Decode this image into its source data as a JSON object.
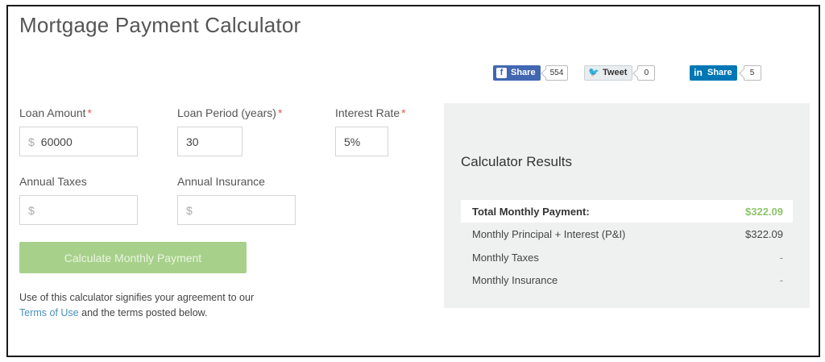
{
  "page": {
    "title": "Mortgage Payment Calculator"
  },
  "social": {
    "facebook": {
      "label": "Share",
      "count": "554",
      "icon": "f"
    },
    "twitter": {
      "label": "Tweet",
      "count": "0",
      "icon": "🐦"
    },
    "linkedin": {
      "label": "Share",
      "count": "5",
      "icon": "in"
    }
  },
  "form": {
    "loan_amount": {
      "label": "Loan Amount",
      "required": "*",
      "prefix": "$",
      "value": "60000"
    },
    "loan_period": {
      "label": "Loan Period (years)",
      "required": "*",
      "value": "30"
    },
    "interest_rate": {
      "label": "Interest Rate",
      "required": "*",
      "value": "5%"
    },
    "annual_taxes": {
      "label": "Annual Taxes",
      "prefix": "$",
      "value": ""
    },
    "annual_insurance": {
      "label": "Annual Insurance",
      "prefix": "$",
      "value": ""
    },
    "calculate_label": "Calculate Monthly Payment"
  },
  "disclaimer": {
    "before": "Use of this calculator signifies your agreement to our ",
    "link": "Terms of Use",
    "after": " and the terms posted below."
  },
  "results": {
    "title": "Calculator Results",
    "rows": [
      {
        "label": "Total Monthly Payment:",
        "value": "$322.09"
      },
      {
        "label": "Monthly Principal + Interest (P&I)",
        "value": "$322.09"
      },
      {
        "label": "Monthly Taxes",
        "value": "-"
      },
      {
        "label": "Monthly Insurance",
        "value": "-"
      }
    ]
  },
  "colors": {
    "accent_green": "#8cc46a",
    "button_green": "#a7d08b",
    "link_blue": "#4a8fbf",
    "required_red": "#e25a4f"
  }
}
